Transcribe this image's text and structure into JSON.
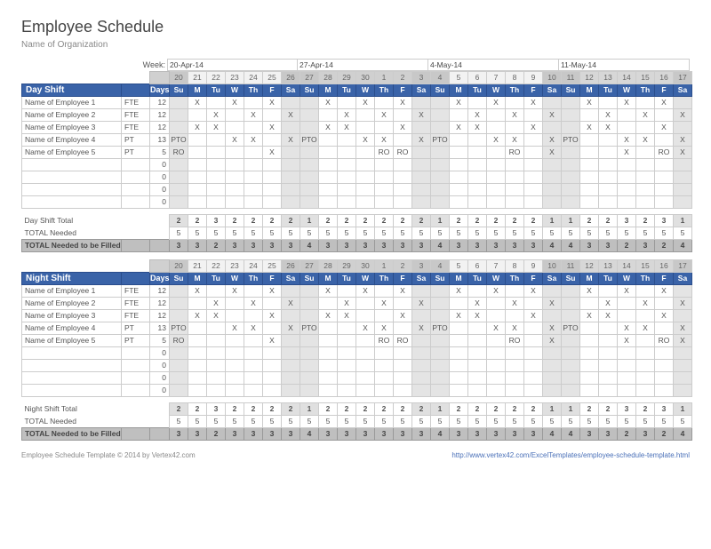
{
  "title": "Employee Schedule",
  "subtitle": "Name of Organization",
  "week_label": "Week:",
  "week_dates": [
    "20-Apr-14",
    "27-Apr-14",
    "4-May-14",
    "11-May-14"
  ],
  "date_nums": [
    "20",
    "21",
    "22",
    "23",
    "24",
    "25",
    "26",
    "27",
    "28",
    "29",
    "30",
    "1",
    "2",
    "3",
    "4",
    "5",
    "6",
    "7",
    "8",
    "9",
    "10",
    "11",
    "12",
    "13",
    "14",
    "15",
    "16",
    "17"
  ],
  "dow": [
    "Su",
    "M",
    "Tu",
    "W",
    "Th",
    "F",
    "Sa",
    "Su",
    "M",
    "Tu",
    "W",
    "Th",
    "F",
    "Sa",
    "Su",
    "M",
    "Tu",
    "W",
    "Th",
    "F",
    "Sa",
    "Su",
    "M",
    "Tu",
    "W",
    "Th",
    "F",
    "Sa"
  ],
  "weekend_idx": [
    0,
    6,
    7,
    13,
    14,
    20,
    21,
    27
  ],
  "week_col_cls": [
    "wk0",
    "wk0",
    "wk0",
    "wk0",
    "wk0",
    "wk0",
    "wk0",
    "wk1",
    "wk1",
    "wk1",
    "wk1",
    "wk1",
    "wk1",
    "wk1",
    "wk2",
    "wk2",
    "wk2",
    "wk2",
    "wk2",
    "wk2",
    "wk2",
    "wk3",
    "wk3",
    "wk3",
    "wk3",
    "wk3",
    "wk3",
    "wk3"
  ],
  "shifts": [
    {
      "name": "Day Shift",
      "days_hdr": "Days",
      "employees": [
        {
          "name": "Name of Employee 1",
          "type": "FTE",
          "days": "12",
          "cells": [
            "",
            "X",
            "",
            "X",
            "",
            "X",
            "",
            "",
            "X",
            "",
            "X",
            "",
            "X",
            "",
            "",
            "X",
            "",
            "X",
            "",
            "X",
            "",
            "",
            "X",
            "",
            "X",
            "",
            "X",
            ""
          ]
        },
        {
          "name": "Name of Employee 2",
          "type": "FTE",
          "days": "12",
          "cells": [
            "",
            "",
            "X",
            "",
            "X",
            "",
            "X",
            "",
            "",
            "X",
            "",
            "X",
            "",
            "X",
            "",
            "",
            "X",
            "",
            "X",
            "",
            "X",
            "",
            "",
            "X",
            "",
            "X",
            "",
            "X"
          ]
        },
        {
          "name": "Name of Employee 3",
          "type": "FTE",
          "days": "12",
          "cells": [
            "",
            "X",
            "X",
            "",
            "",
            "X",
            "",
            "",
            "X",
            "X",
            "",
            "",
            "X",
            "",
            "",
            "X",
            "X",
            "",
            "",
            "X",
            "",
            "",
            "X",
            "X",
            "",
            "",
            "X",
            ""
          ]
        },
        {
          "name": "Name of Employee 4",
          "type": "PT",
          "days": "13",
          "cells": [
            "PTO",
            "",
            "",
            "X",
            "X",
            "",
            "X",
            "PTO",
            "",
            "",
            "X",
            "X",
            "",
            "X",
            "PTO",
            "",
            "",
            "X",
            "X",
            "",
            "X",
            "PTO",
            "",
            "",
            "X",
            "X",
            "",
            "X"
          ]
        },
        {
          "name": "Name of Employee 5",
          "type": "PT",
          "days": "5",
          "cells": [
            "RO",
            "",
            "",
            "",
            "",
            "X",
            "",
            "",
            "",
            "",
            "",
            "RO",
            "RO",
            "",
            "",
            "",
            "",
            "",
            "RO",
            "",
            "X",
            "",
            "",
            "",
            "X",
            "",
            "RO",
            "X"
          ]
        },
        {
          "name": "",
          "type": "",
          "days": "0",
          "cells": [
            "",
            "",
            "",
            "",
            "",
            "",
            "",
            "",
            "",
            "",
            "",
            "",
            "",
            "",
            "",
            "",
            "",
            "",
            "",
            "",
            "",
            "",
            "",
            "",
            "",
            "",
            "",
            ""
          ]
        },
        {
          "name": "",
          "type": "",
          "days": "0",
          "cells": [
            "",
            "",
            "",
            "",
            "",
            "",
            "",
            "",
            "",
            "",
            "",
            "",
            "",
            "",
            "",
            "",
            "",
            "",
            "",
            "",
            "",
            "",
            "",
            "",
            "",
            "",
            "",
            ""
          ]
        },
        {
          "name": "",
          "type": "",
          "days": "0",
          "cells": [
            "",
            "",
            "",
            "",
            "",
            "",
            "",
            "",
            "",
            "",
            "",
            "",
            "",
            "",
            "",
            "",
            "",
            "",
            "",
            "",
            "",
            "",
            "",
            "",
            "",
            "",
            "",
            ""
          ]
        },
        {
          "name": "",
          "type": "",
          "days": "0",
          "cells": [
            "",
            "",
            "",
            "",
            "",
            "",
            "",
            "",
            "",
            "",
            "",
            "",
            "",
            "",
            "",
            "",
            "",
            "",
            "",
            "",
            "",
            "",
            "",
            "",
            "",
            "",
            "",
            ""
          ]
        }
      ],
      "total_label": "Day Shift Total",
      "total": [
        "2",
        "2",
        "3",
        "2",
        "2",
        "2",
        "2",
        "1",
        "2",
        "2",
        "2",
        "2",
        "2",
        "2",
        "1",
        "2",
        "2",
        "2",
        "2",
        "2",
        "1",
        "1",
        "2",
        "2",
        "3",
        "2",
        "3",
        "1"
      ],
      "needed_label": "TOTAL Needed",
      "needed": [
        "5",
        "5",
        "5",
        "5",
        "5",
        "5",
        "5",
        "5",
        "5",
        "5",
        "5",
        "5",
        "5",
        "5",
        "5",
        "5",
        "5",
        "5",
        "5",
        "5",
        "5",
        "5",
        "5",
        "5",
        "5",
        "5",
        "5",
        "5"
      ],
      "fill_label": "TOTAL Needed to be Filled",
      "fill": [
        "3",
        "3",
        "2",
        "3",
        "3",
        "3",
        "3",
        "4",
        "3",
        "3",
        "3",
        "3",
        "3",
        "3",
        "4",
        "3",
        "3",
        "3",
        "3",
        "3",
        "4",
        "4",
        "3",
        "3",
        "2",
        "3",
        "2",
        "4"
      ]
    },
    {
      "name": "Night Shift",
      "days_hdr": "Days",
      "employees": [
        {
          "name": "Name of Employee 1",
          "type": "FTE",
          "days": "12",
          "cells": [
            "",
            "X",
            "",
            "X",
            "",
            "X",
            "",
            "",
            "X",
            "",
            "X",
            "",
            "X",
            "",
            "",
            "X",
            "",
            "X",
            "",
            "X",
            "",
            "",
            "X",
            "",
            "X",
            "",
            "X",
            ""
          ]
        },
        {
          "name": "Name of Employee 2",
          "type": "FTE",
          "days": "12",
          "cells": [
            "",
            "",
            "X",
            "",
            "X",
            "",
            "X",
            "",
            "",
            "X",
            "",
            "X",
            "",
            "X",
            "",
            "",
            "X",
            "",
            "X",
            "",
            "X",
            "",
            "",
            "X",
            "",
            "X",
            "",
            "X"
          ]
        },
        {
          "name": "Name of Employee 3",
          "type": "FTE",
          "days": "12",
          "cells": [
            "",
            "X",
            "X",
            "",
            "",
            "X",
            "",
            "",
            "X",
            "X",
            "",
            "",
            "X",
            "",
            "",
            "X",
            "X",
            "",
            "",
            "X",
            "",
            "",
            "X",
            "X",
            "",
            "",
            "X",
            ""
          ]
        },
        {
          "name": "Name of Employee 4",
          "type": "PT",
          "days": "13",
          "cells": [
            "PTO",
            "",
            "",
            "X",
            "X",
            "",
            "X",
            "PTO",
            "",
            "",
            "X",
            "X",
            "",
            "X",
            "PTO",
            "",
            "",
            "X",
            "X",
            "",
            "X",
            "PTO",
            "",
            "",
            "X",
            "X",
            "",
            "X"
          ]
        },
        {
          "name": "Name of Employee 5",
          "type": "PT",
          "days": "5",
          "cells": [
            "RO",
            "",
            "",
            "",
            "",
            "X",
            "",
            "",
            "",
            "",
            "",
            "RO",
            "RO",
            "",
            "",
            "",
            "",
            "",
            "RO",
            "",
            "X",
            "",
            "",
            "",
            "X",
            "",
            "RO",
            "X"
          ]
        },
        {
          "name": "",
          "type": "",
          "days": "0",
          "cells": [
            "",
            "",
            "",
            "",
            "",
            "",
            "",
            "",
            "",
            "",
            "",
            "",
            "",
            "",
            "",
            "",
            "",
            "",
            "",
            "",
            "",
            "",
            "",
            "",
            "",
            "",
            "",
            ""
          ]
        },
        {
          "name": "",
          "type": "",
          "days": "0",
          "cells": [
            "",
            "",
            "",
            "",
            "",
            "",
            "",
            "",
            "",
            "",
            "",
            "",
            "",
            "",
            "",
            "",
            "",
            "",
            "",
            "",
            "",
            "",
            "",
            "",
            "",
            "",
            "",
            ""
          ]
        },
        {
          "name": "",
          "type": "",
          "days": "0",
          "cells": [
            "",
            "",
            "",
            "",
            "",
            "",
            "",
            "",
            "",
            "",
            "",
            "",
            "",
            "",
            "",
            "",
            "",
            "",
            "",
            "",
            "",
            "",
            "",
            "",
            "",
            "",
            "",
            ""
          ]
        },
        {
          "name": "",
          "type": "",
          "days": "0",
          "cells": [
            "",
            "",
            "",
            "",
            "",
            "",
            "",
            "",
            "",
            "",
            "",
            "",
            "",
            "",
            "",
            "",
            "",
            "",
            "",
            "",
            "",
            "",
            "",
            "",
            "",
            "",
            "",
            ""
          ]
        }
      ],
      "total_label": "Night Shift Total",
      "total": [
        "2",
        "2",
        "3",
        "2",
        "2",
        "2",
        "2",
        "1",
        "2",
        "2",
        "2",
        "2",
        "2",
        "2",
        "1",
        "2",
        "2",
        "2",
        "2",
        "2",
        "1",
        "1",
        "2",
        "2",
        "3",
        "2",
        "3",
        "1"
      ],
      "needed_label": "TOTAL Needed",
      "needed": [
        "5",
        "5",
        "5",
        "5",
        "5",
        "5",
        "5",
        "5",
        "5",
        "5",
        "5",
        "5",
        "5",
        "5",
        "5",
        "5",
        "5",
        "5",
        "5",
        "5",
        "5",
        "5",
        "5",
        "5",
        "5",
        "5",
        "5",
        "5"
      ],
      "fill_label": "TOTAL Needed to be Filled",
      "fill": [
        "3",
        "3",
        "2",
        "3",
        "3",
        "3",
        "3",
        "4",
        "3",
        "3",
        "3",
        "3",
        "3",
        "3",
        "4",
        "3",
        "3",
        "3",
        "3",
        "3",
        "4",
        "4",
        "3",
        "3",
        "2",
        "3",
        "2",
        "4"
      ]
    }
  ],
  "footer_left": "Employee Schedule Template © 2014 by Vertex42.com",
  "footer_right": "http://www.vertex42.com/ExcelTemplates/employee-schedule-template.html"
}
